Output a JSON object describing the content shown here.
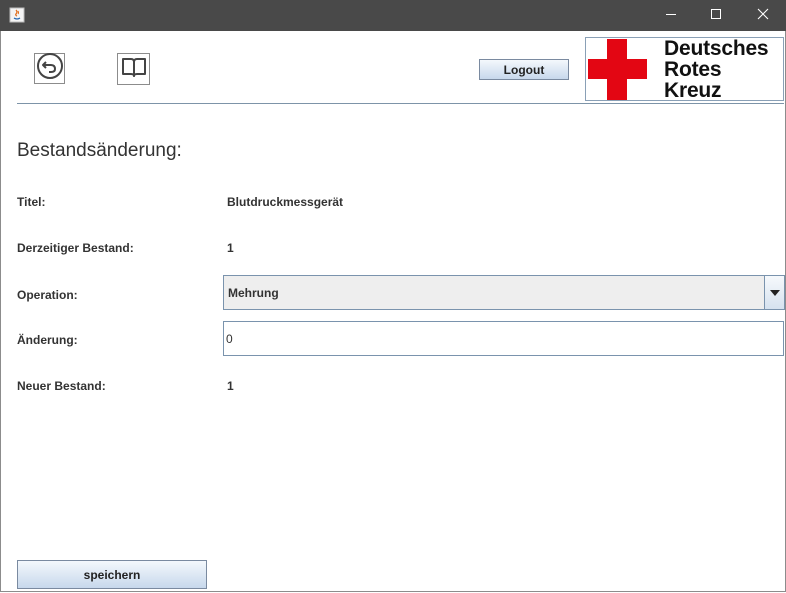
{
  "window": {
    "icons": {
      "app": "java-icon",
      "minimize": "minimize-icon",
      "maximize": "maximize-icon",
      "close": "close-icon"
    }
  },
  "toolbar": {
    "back_icon": "back-arrow-icon",
    "book_icon": "book-icon",
    "logout_label": "Logout"
  },
  "logo": {
    "lines": [
      "Deutsches",
      "Rotes",
      "Kreuz"
    ],
    "cross_color": "#e30613"
  },
  "form": {
    "heading": "Bestandsänderung:",
    "title_label": "Titel:",
    "title_value": "Blutdruckmessgerät",
    "stock_label": "Derzeitiger Bestand:",
    "stock_value": "1",
    "operation_label": "Operation:",
    "operation_value": "Mehrung",
    "change_label": "Änderung:",
    "change_value": "0",
    "new_stock_label": "Neuer Bestand:",
    "new_stock_value": "1"
  },
  "actions": {
    "save_label": "speichern"
  }
}
